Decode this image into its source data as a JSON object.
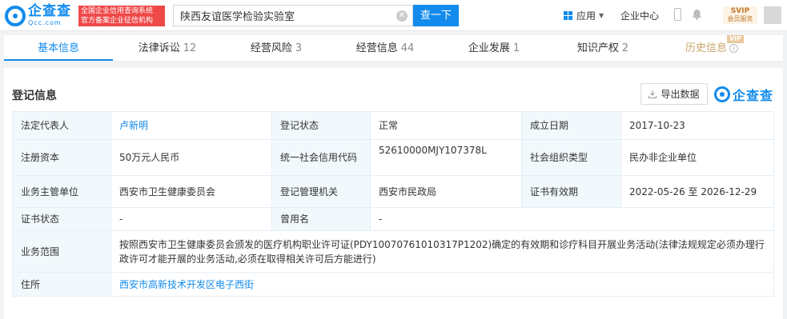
{
  "header": {
    "logo_cn": "企查查",
    "logo_en": "Qcc.com",
    "slogan_line1": "全国企业信用查询系统",
    "slogan_line2": "官方备案企业征信机构",
    "search_value": "陕西友谊医学检验实验室",
    "search_button": "查一下",
    "app_menu": "应用",
    "enterprise_center": "企业中心",
    "svip_top": "SVIP",
    "svip_bottom": "会员服务"
  },
  "tabs": [
    {
      "label": "基本信息",
      "count": ""
    },
    {
      "label": "法律诉讼",
      "count": "12"
    },
    {
      "label": "经营风险",
      "count": "3"
    },
    {
      "label": "经营信息",
      "count": "44"
    },
    {
      "label": "企业发展",
      "count": "1"
    },
    {
      "label": "知识产权",
      "count": "2"
    },
    {
      "label": "历史信息",
      "count": "",
      "badge": "VIP"
    }
  ],
  "section": {
    "title": "登记信息",
    "export_label": "导出数据",
    "brand": "企查查"
  },
  "registration": {
    "legal_rep_label": "法定代表人",
    "legal_rep": "卢新明",
    "reg_status_label": "登记状态",
    "reg_status": "正常",
    "established_label": "成立日期",
    "established": "2017-10-23",
    "reg_capital_label": "注册资本",
    "reg_capital": "50万元人民币",
    "credit_code_label": "统一社会信用代码",
    "credit_code": "52610000MJY107378L",
    "org_type_label": "社会组织类型",
    "org_type": "民办非企业单位",
    "supervisor_label": "业务主管单位",
    "supervisor": "西安市卫生健康委员会",
    "reg_authority_label": "登记管理机关",
    "reg_authority": "西安市民政局",
    "cert_valid_label": "证书有效期",
    "cert_valid": "2022-05-26 至 2026-12-29",
    "cert_status_label": "证书状态",
    "cert_status": "-",
    "former_name_label": "曾用名",
    "former_name": "-",
    "scope_label": "业务范围",
    "scope": "按照西安市卫生健康委员会颁发的医疗机构职业许可证(PDY10070761010317P1202)确定的有效期和诊疗科目开展业务活动(法律法规规定必须办理行政许可才能开展的业务活动,必须在取得相关许可后方能进行)",
    "address_label": "住所",
    "address": "西安市高新技术开发区电子西街"
  },
  "colors": {
    "brand_blue": "#128bed",
    "label_bg": "#f2f9fc",
    "vip_gold": "#c8a36b",
    "slogan_red": "#ef4848"
  }
}
